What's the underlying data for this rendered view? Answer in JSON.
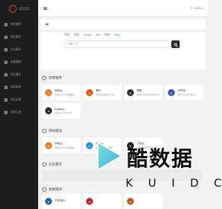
{
  "topbar": {
    "github_label": "GitHub"
  },
  "sidebar": {
    "items": [
      {
        "label": "常用推荐"
      },
      {
        "label": "网站建设"
      },
      {
        "label": "企业服务"
      },
      {
        "label": "金融理财"
      },
      {
        "label": "社交通讯"
      },
      {
        "label": "常用网站"
      },
      {
        "label": "站长必备"
      },
      {
        "label": "实用工具"
      }
    ]
  },
  "notice": {
    "icon": "speaker-icon"
  },
  "search": {
    "tabs": [
      "常用",
      "百度",
      "Google",
      "360",
      "搜狗",
      "Bing"
    ],
    "active_tab": 1,
    "placeholder": "百度一下"
  },
  "sections": [
    {
      "title": "常用推荐"
    },
    {
      "title": "网站建设"
    },
    {
      "title": "企业服务"
    },
    {
      "title": "金融理财"
    }
  ],
  "cards": {
    "recommend": [
      {
        "name": "网易云",
        "desc": "网易云1000万首歌曲...",
        "color": "#f07a2a"
      },
      {
        "name": "腾讯",
        "desc": "全球领先的数字平台",
        "color": "#e65c12"
      },
      {
        "name": "猫眼",
        "desc": "中国人气最高的电影平台",
        "color": "#333333"
      },
      {
        "name": "UI中国",
        "desc": "图形交互设计师平台",
        "color": "#3d5aa8"
      },
      {
        "name": "Dribbble",
        "desc": "全球最大的设计师",
        "color": "#2b2e31"
      }
    ],
    "website": [
      {
        "name": "网易云",
        "desc": "网易云1000万首歌曲...",
        "color": "#f07a2a"
      },
      {
        "name": "七牛云",
        "desc": "国内领先的云服务",
        "color": "#2a98d8"
      },
      {
        "name": "又拍云",
        "desc": "加速您的数字应用",
        "color": "#1e1e1e"
      }
    ],
    "finance": [
      {
        "name": "中金银行",
        "desc": "",
        "color": "#2466a8"
      },
      {
        "name": "",
        "desc": "",
        "color": "#c02d2d"
      },
      {
        "name": "",
        "desc": "",
        "color": "#c65a1a"
      }
    ]
  },
  "watermark": {
    "text": "酷数据",
    "letters": [
      "K",
      "U",
      "I",
      "D",
      "C"
    ]
  }
}
